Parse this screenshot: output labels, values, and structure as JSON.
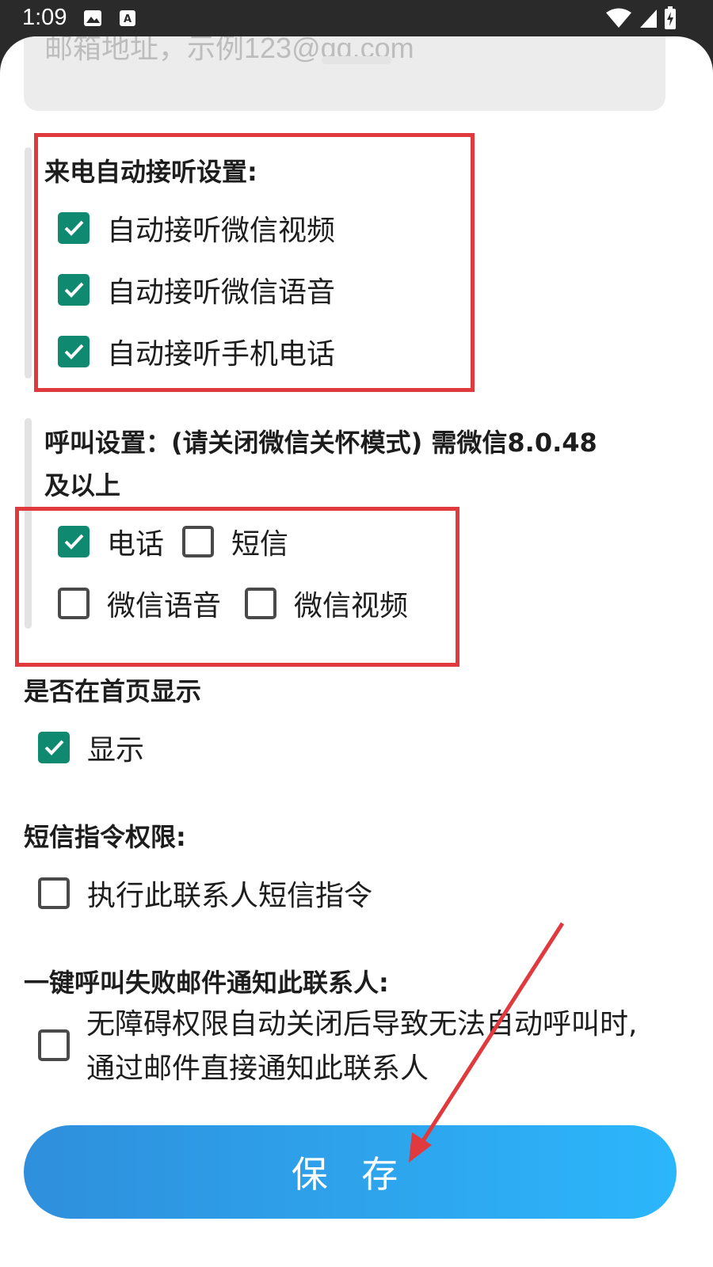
{
  "status_bar": {
    "time": "1:09"
  },
  "email": {
    "placeholder": "邮箱地址，示例123@qq.com"
  },
  "auto_answer": {
    "heading": "来电自动接听设置:",
    "items": [
      {
        "label": "自动接听微信视频",
        "checked": true
      },
      {
        "label": "自动接听微信语音",
        "checked": true
      },
      {
        "label": "自动接听手机电话",
        "checked": true
      }
    ]
  },
  "call_settings": {
    "heading_line1": "呼叫设置：(请关闭微信关怀模式) 需微信8.0.48",
    "heading_line2": "及以上",
    "options": [
      {
        "label": "电话",
        "checked": true
      },
      {
        "label": "短信",
        "checked": false
      },
      {
        "label": "微信语音",
        "checked": false
      },
      {
        "label": "微信视频",
        "checked": false
      }
    ]
  },
  "home_display": {
    "heading": "是否在首页显示",
    "option": {
      "label": "显示",
      "checked": true
    }
  },
  "sms_permission": {
    "heading": "短信指令权限:",
    "option": {
      "label": "执行此联系人短信指令",
      "checked": false
    }
  },
  "email_notify": {
    "heading": "一键呼叫失败邮件通知此联系人:",
    "option": {
      "line1": "无障碍权限自动关闭后导致无法自动呼叫时,",
      "line2": "通过邮件直接通知此联系人",
      "checked": false
    }
  },
  "save_button": {
    "label": "保 存"
  },
  "colors": {
    "checkbox_checked": "#0f8a70",
    "annotation_red": "#e0393e",
    "button_start": "#2f8fdc",
    "button_end": "#2cb6fb"
  }
}
